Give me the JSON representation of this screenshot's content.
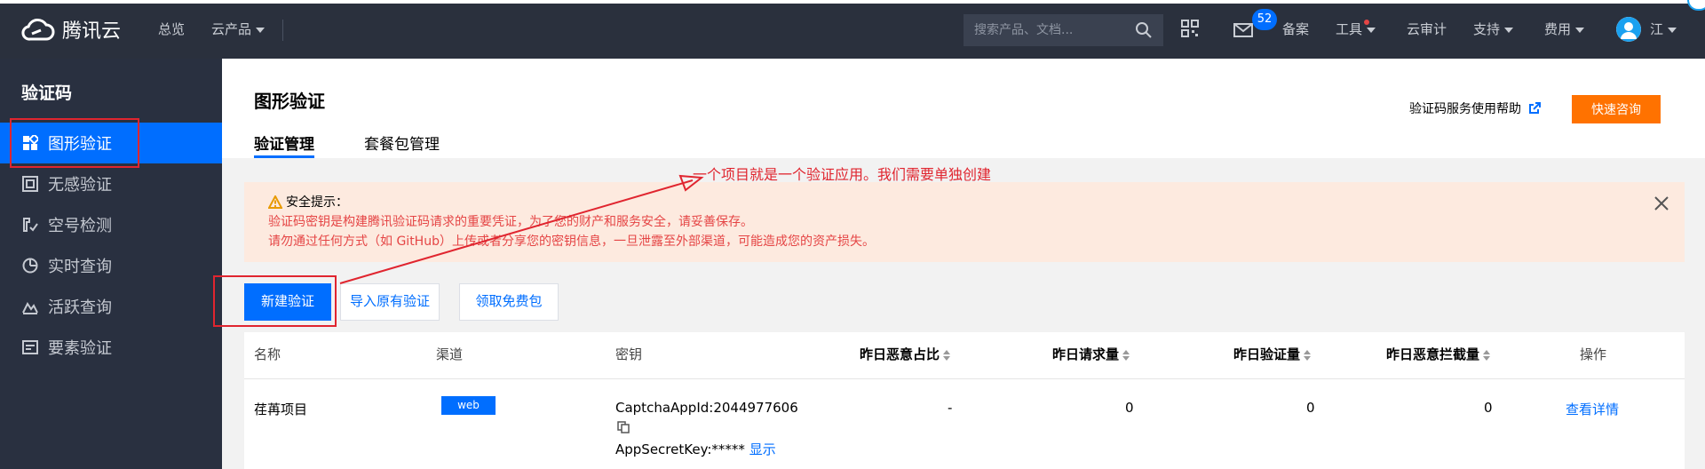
{
  "topbar": {
    "brand": "腾讯云",
    "nav": {
      "overview": "总览",
      "products": "云产品"
    },
    "search_placeholder": "搜索产品、文档...",
    "badge_count": "52",
    "links": {
      "filing": "备案",
      "tools": "工具",
      "audit": "云审计",
      "support": "支持",
      "billing": "费用"
    },
    "user": "江"
  },
  "sidebar": {
    "title": "验证码",
    "items": [
      {
        "label": "图形验证",
        "icon": "grid-icon",
        "active": true
      },
      {
        "label": "无感验证",
        "icon": "frame-icon"
      },
      {
        "label": "空号检测",
        "icon": "phone-check-icon"
      },
      {
        "label": "实时查询",
        "icon": "pie-icon"
      },
      {
        "label": "活跃查询",
        "icon": "mountain-chart-icon"
      },
      {
        "label": "要素验证",
        "icon": "card-icon"
      }
    ]
  },
  "main": {
    "title": "图形验证",
    "help_link": "验证码服务使用帮助",
    "consult_button": "快速咨询",
    "tabs": [
      {
        "label": "验证管理",
        "active": true
      },
      {
        "label": "套餐包管理"
      }
    ],
    "alert": {
      "title": "安全提示：",
      "line1": "验证码密钥是构建腾讯验证码请求的重要凭证，为了您的财产和服务安全，请妥善保存。",
      "line2": "请勿通过任何方式（如 GitHub）上传或者分享您的密钥信息，一旦泄露至外部渠道，可能造成您的资产损失。"
    },
    "buttons": {
      "create": "新建验证",
      "import": "导入原有验证",
      "free": "领取免费包"
    },
    "table": {
      "headers": [
        "名称",
        "渠道",
        "密钥",
        "昨日恶意占比",
        "昨日请求量",
        "昨日验证量",
        "昨日恶意拦截量",
        "操作"
      ],
      "rows": [
        {
          "name": "荏苒项目",
          "channel": "web",
          "appid": "CaptchaAppId:2044977606",
          "secret": "AppSecretKey:*****",
          "show": "显示",
          "malicious_ratio": "-",
          "requests": "0",
          "verifications": "0",
          "blocked": "0",
          "action": "查看详情"
        }
      ]
    }
  },
  "annotation": "一个项目就是一个验证应用。我们需要单独创建",
  "colors": {
    "accent": "#006eff",
    "orange": "#ff7200",
    "annotation": "#e0252f"
  }
}
